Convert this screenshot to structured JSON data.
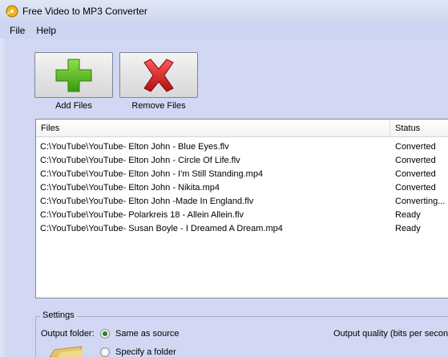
{
  "window": {
    "title": "Free Video to MP3 Converter"
  },
  "menu": [
    {
      "label": "File"
    },
    {
      "label": "Help"
    }
  ],
  "toolbar": {
    "add_label": "Add Files",
    "remove_label": "Remove Files",
    "add_icon": "plus-icon",
    "remove_icon": "x-icon"
  },
  "file_list": {
    "columns": [
      "Files",
      "Status"
    ],
    "rows": [
      {
        "file": "C:\\YouTube\\YouTube- Elton John - Blue Eyes.flv",
        "status": "Converted"
      },
      {
        "file": "C:\\YouTube\\YouTube- Elton John - Circle Of Life.flv",
        "status": "Converted"
      },
      {
        "file": "C:\\YouTube\\YouTube- Elton John - I'm Still Standing.mp4",
        "status": "Converted"
      },
      {
        "file": "C:\\YouTube\\YouTube- Elton John - Nikita.mp4",
        "status": "Converted"
      },
      {
        "file": "C:\\YouTube\\YouTube- Elton John -Made In England.flv",
        "status": "Converting..."
      },
      {
        "file": "C:\\YouTube\\YouTube- Polarkreis 18 - Allein Allein.flv",
        "status": "Ready"
      },
      {
        "file": "C:\\YouTube\\YouTube- Susan Boyle - I Dreamed A Dream.mp4",
        "status": "Ready"
      }
    ]
  },
  "settings": {
    "legend": "Settings",
    "output_folder_label": "Output folder:",
    "options": [
      {
        "label": "Same as source",
        "selected": true
      },
      {
        "label": "Specify a folder",
        "selected": false
      }
    ],
    "quality_label": "Output quality (bits per second"
  },
  "colors": {
    "plus_green": "#5bbd1f",
    "x_red": "#cc1f1f",
    "background": "#d2d8f3"
  }
}
